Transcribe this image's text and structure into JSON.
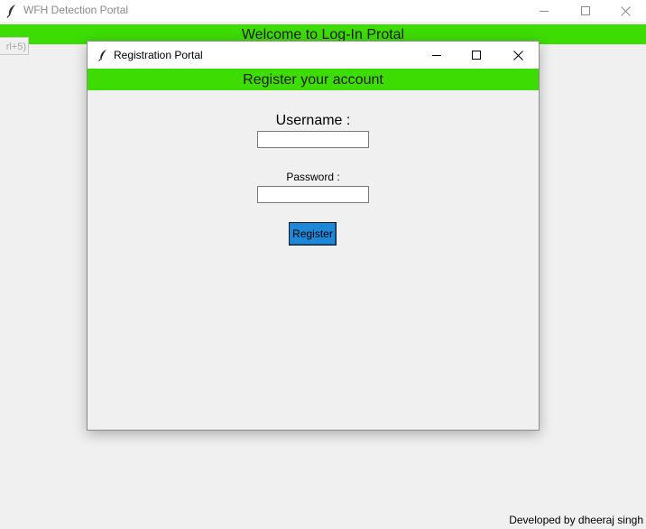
{
  "main_window": {
    "title": "WFH Detection Portal",
    "banner": "Welcome to Log-In Protal",
    "side_button_text": "rl+5)",
    "footer": "Developed by dheeraj singh"
  },
  "dialog": {
    "title": "Registration Portal",
    "banner": "Register your account",
    "username_label": "Username :",
    "username_value": "",
    "password_label": "Password :",
    "password_value": "",
    "register_button": "Register"
  },
  "colors": {
    "banner_green": "#3ddd04",
    "button_blue": "#1e88d8",
    "window_bg": "#f0f0f0"
  },
  "icons": {
    "app_icon": "feather-icon",
    "minimize": "minimize-icon",
    "maximize": "maximize-icon",
    "close": "close-icon"
  }
}
